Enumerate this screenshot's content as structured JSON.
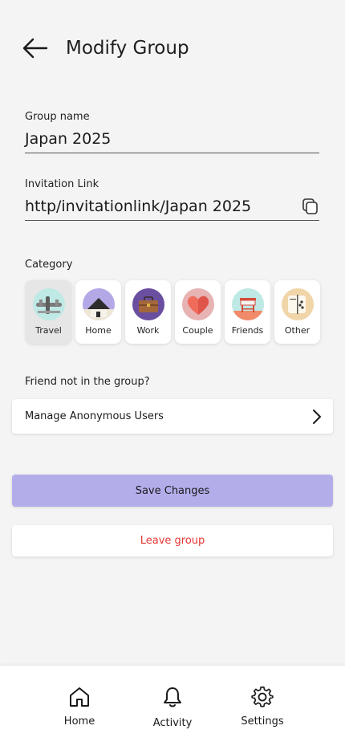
{
  "header": {
    "title": "Modify Group",
    "back_icon": "arrow-left-icon"
  },
  "group_name": {
    "label": "Group name",
    "value": "Japan 2025"
  },
  "invitation": {
    "label": "Invitation Link",
    "value": "http/invitationlink/Japan 2025",
    "copy_icon": "copy-icon"
  },
  "category": {
    "label": "Category",
    "selected": "Travel",
    "items": [
      {
        "label": "Travel",
        "icon": "airplane-icon",
        "bg": "#bfe9e4"
      },
      {
        "label": "Home",
        "icon": "house-icon",
        "bg": "#b4a9e6"
      },
      {
        "label": "Work",
        "icon": "briefcase-icon",
        "bg": "#6a4fa0"
      },
      {
        "label": "Couple",
        "icon": "heart-icon",
        "bg": "#e7b3b3"
      },
      {
        "label": "Friends",
        "icon": "lifeguard-tower-icon",
        "bg": "#bfe9e4"
      },
      {
        "label": "Other",
        "icon": "dice-icon",
        "bg": "#f0d5a9"
      }
    ]
  },
  "friends": {
    "label": "Friend not in the group?",
    "manage_label": "Manage Anonymous Users"
  },
  "actions": {
    "save_label": "Save Changes",
    "leave_label": "Leave group"
  },
  "colors": {
    "accent": "#b3aeea",
    "danger": "#e53935",
    "background": "#f4f4f4"
  },
  "bottom_nav": [
    {
      "label": "Home",
      "icon": "home-icon"
    },
    {
      "label": "Activity",
      "icon": "bell-icon"
    },
    {
      "label": "Settings",
      "icon": "gear-icon"
    }
  ]
}
